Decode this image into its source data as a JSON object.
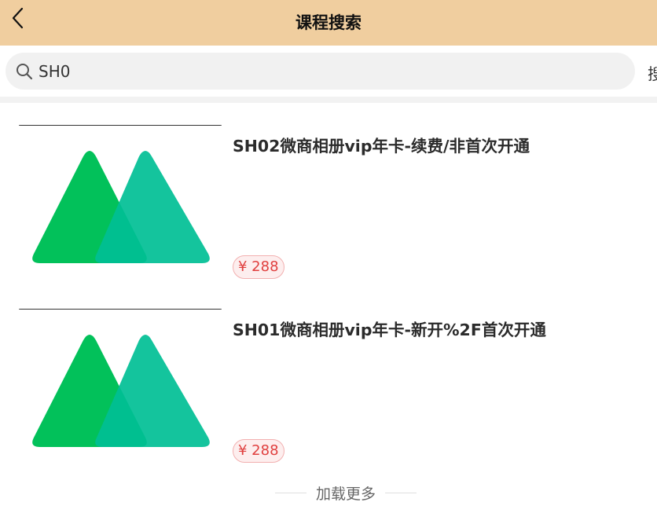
{
  "header": {
    "title": "课程搜索",
    "back_icon": "chevron-left-icon",
    "background": "#f0ce9f"
  },
  "search": {
    "icon": "search-icon",
    "value": "SH0",
    "button_label": "搜索"
  },
  "courses": [
    {
      "title": "SH02微商相册vip年卡-续费/非首次开通",
      "price": "¥ 288",
      "thumbnail_icon": "green-mountains-logo-icon"
    },
    {
      "title": "SH01微商相册vip年卡-新开%2F首次开通",
      "price": "¥ 288",
      "thumbnail_icon": "green-mountains-logo-icon"
    }
  ],
  "load_more": {
    "label": "加载更多"
  },
  "colors": {
    "price_text": "#e0403f",
    "logo_green_left": "#02c15a",
    "logo_green_right": "#00c094"
  }
}
